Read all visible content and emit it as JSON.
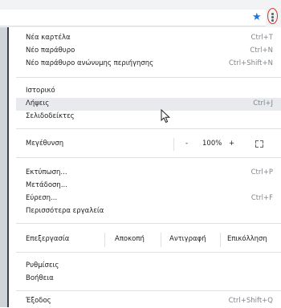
{
  "toolbar": {
    "star_icon": "star-icon",
    "menu_icon": "kebab-menu-icon"
  },
  "menu": {
    "new_tab": {
      "label": "Νέα καρτέλα",
      "shortcut": "Ctrl+T"
    },
    "new_window": {
      "label": "Νέο παράθυρο",
      "shortcut": "Ctrl+N"
    },
    "incognito": {
      "label": "Νέο παράθυρο ανώνυμης περιήγησης",
      "shortcut": "Ctrl+Shift+N"
    },
    "history": {
      "label": "Ιστορικό"
    },
    "downloads": {
      "label": "Λήψεις",
      "shortcut": "Ctrl+J"
    },
    "bookmarks": {
      "label": "Σελιδοδείκτες"
    },
    "zoom": {
      "label": "Μεγέθυνση",
      "minus": "-",
      "value": "100%",
      "plus": "+"
    },
    "print": {
      "label": "Εκτύπωση...",
      "shortcut": "Ctrl+P"
    },
    "cast": {
      "label": "Μετάδοση..."
    },
    "find": {
      "label": "Εύρεση...",
      "shortcut": "Ctrl+F"
    },
    "more_tools": {
      "label": "Περισσότερα εργαλεία"
    },
    "edit": {
      "label": "Επεξεργασία",
      "cut": "Αποκοπή",
      "copy": "Αντιγραφή",
      "paste": "Επικόλληση"
    },
    "settings": {
      "label": "Ρυθμίσεις"
    },
    "help": {
      "label": "Βοήθεια"
    },
    "exit": {
      "label": "Έξοδος",
      "shortcut": "Ctrl+Shift+Q"
    }
  }
}
